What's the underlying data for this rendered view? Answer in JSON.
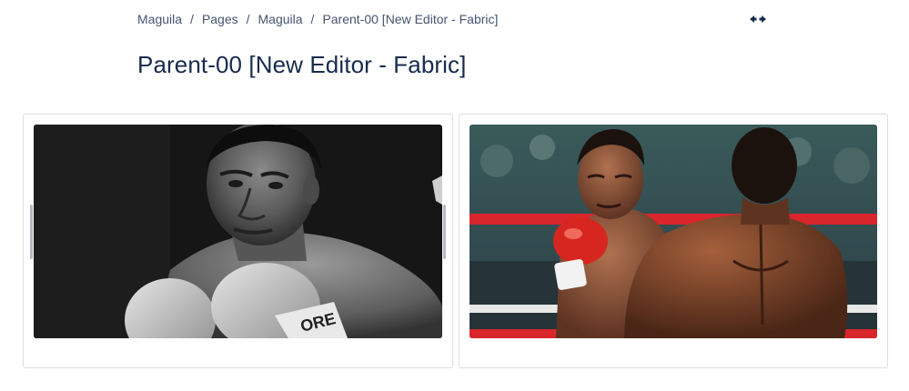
{
  "breadcrumb": {
    "items": [
      "Maguila",
      "Pages",
      "Maguila",
      "Parent-00 [New Editor - Fabric]"
    ],
    "separator": "/"
  },
  "header": {
    "width_toggle_icon": "expand-width-icon"
  },
  "page": {
    "title": "Parent-00 [New Editor - Fabric]"
  },
  "layout": {
    "columns": [
      {
        "media": {
          "type": "image",
          "description_icon": "boxer-photo-bw",
          "colors": {
            "background": "#1a1a1a",
            "glove": "#d8d8d8"
          }
        },
        "resize_handles": [
          "left",
          "right"
        ]
      },
      {
        "media": {
          "type": "image",
          "description_icon": "boxer-photo-color",
          "colors": {
            "ropes": "#d8262c",
            "glove": "#d7261f",
            "skin": "#8a5236"
          }
        }
      }
    ]
  }
}
